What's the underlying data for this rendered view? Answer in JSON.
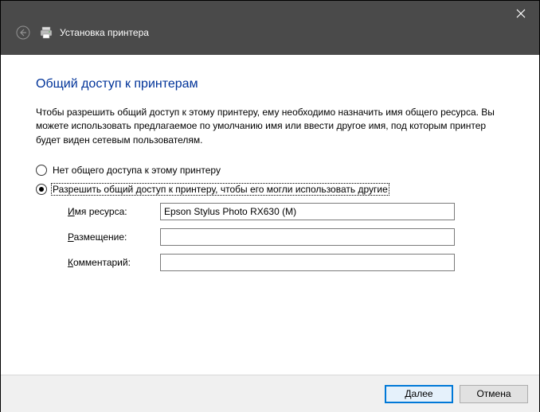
{
  "header": {
    "title": "Установка принтера"
  },
  "content": {
    "heading": "Общий доступ к принтерам",
    "description": "Чтобы разрешить общий доступ к этому принтеру, ему необходимо назначить имя общего ресурса. Вы можете использовать предлагаемое по умолчанию имя или ввести другое имя, под которым принтер будет виден сетевым пользователям.",
    "radios": {
      "no_share": "Нет общего доступа к этому принтеру",
      "share": "Разрешить общий доступ к принтеру, чтобы его могли использовать другие"
    },
    "fields": {
      "share_name": {
        "label_pre": "",
        "label_accel": "И",
        "label_post": "мя ресурса:",
        "value": "Epson Stylus Photo RX630 (M)"
      },
      "location": {
        "label_pre": "",
        "label_accel": "Р",
        "label_post": "азмещение:",
        "value": ""
      },
      "comment": {
        "label_pre": "",
        "label_accel": "К",
        "label_post": "омментарий:",
        "value": ""
      }
    }
  },
  "footer": {
    "next_pre": "",
    "next_accel": "Д",
    "next_post": "алее",
    "cancel": "Отмена"
  }
}
